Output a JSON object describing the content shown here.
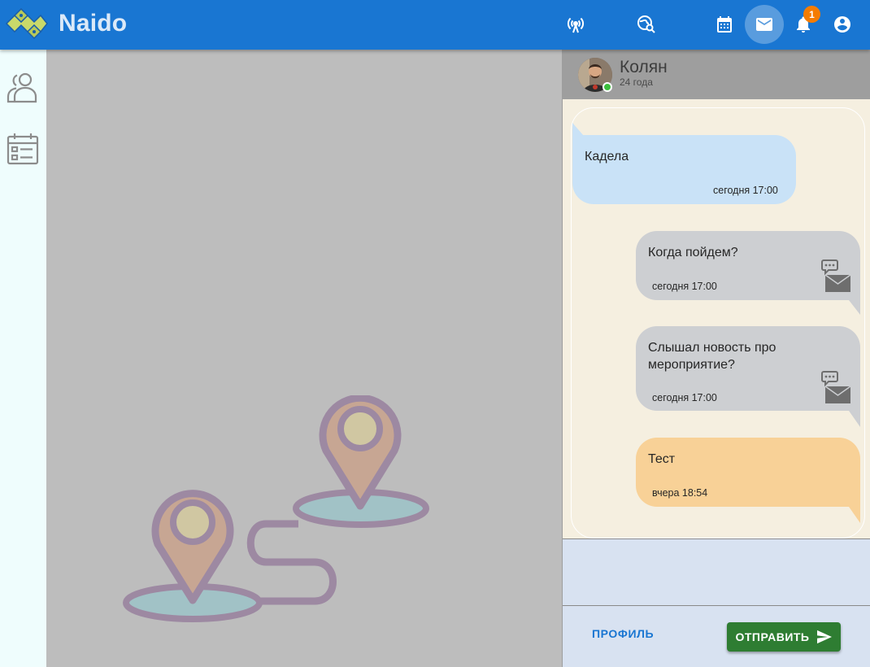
{
  "app": {
    "title": "Naido"
  },
  "topbar": {
    "badge_count": "1",
    "icons": [
      "broadcast-icon",
      "map-search-icon",
      "calendar-icon",
      "mail-icon",
      "bell-icon",
      "account-icon"
    ],
    "active_color": "#1976d2"
  },
  "sidebar": {
    "icons": [
      "friends-icon",
      "events-calendar-icon"
    ]
  },
  "chat": {
    "contact": {
      "name": "Колян",
      "age": "24 года",
      "online": true
    },
    "messages": [
      {
        "direction": "incoming",
        "text": "Кадела",
        "time": "сегодня 17:00"
      },
      {
        "direction": "outgoing",
        "text": "Когда пойдем?",
        "time": "сегодня 17:00",
        "icon": "chat-envelope-icon"
      },
      {
        "direction": "outgoing",
        "text": "Слышал новость про мероприятие?",
        "time": "сегодня 17:00",
        "icon": "chat-envelope-icon"
      },
      {
        "direction": "outgoing",
        "text": "Тест",
        "time": "вчера 18:54"
      }
    ],
    "input": {
      "value": ""
    },
    "actions": {
      "profile_label": "ПРОФИЛЬ",
      "send_label": "ОТПРАВИТЬ"
    }
  },
  "colors": {
    "topbar": "#1976d2",
    "send_button": "#2e7d32",
    "incoming_bubble": "#c9e2f7",
    "outgoing_bubble": "#cdcfd2",
    "highlight_bubble": "#f8d197",
    "badge": "#f57c00"
  }
}
